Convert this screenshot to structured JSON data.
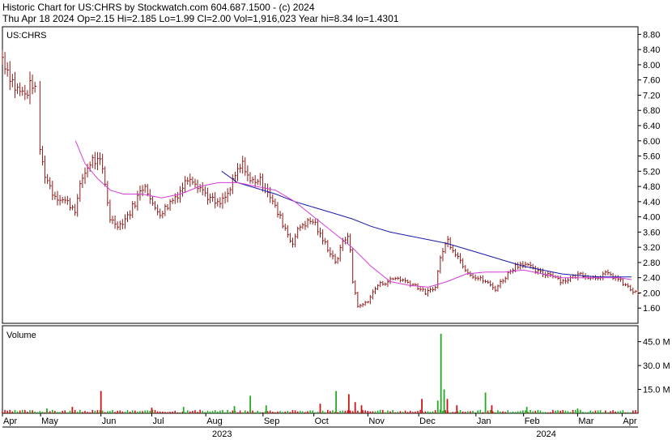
{
  "header": {
    "line1": "Historic Chart for US:CHRS by Stockwatch.com 604.687.1500 - (c) 2024",
    "line2": "Thu Apr 18 2024   Op=2.15   Hi=2.185   Lo=1.99   Cl=2.00   Vol=1,916,023   Year hi=8.34   lo=1.4301"
  },
  "chart_data": {
    "type": "ohlc",
    "symbol_label": "US:CHRS",
    "volume_label": "Volume",
    "price_axis": {
      "min": 1.2,
      "max": 9.0,
      "ticks": [
        "8.80",
        "8.40",
        "8.00",
        "7.60",
        "7.20",
        "6.80",
        "6.40",
        "6.00",
        "5.60",
        "5.20",
        "4.80",
        "4.40",
        "4.00",
        "3.60",
        "3.20",
        "2.80",
        "2.40",
        "2.00",
        "1.60"
      ]
    },
    "volume_axis": {
      "min": 0,
      "max": 55,
      "unit": "M",
      "ticks": [
        {
          "v": 45,
          "label": "45.0 M"
        },
        {
          "v": 30,
          "label": "30.0 M"
        },
        {
          "v": 15,
          "label": "15.0 M"
        }
      ]
    },
    "months": [
      {
        "label": "Apr",
        "x": 0.0
      },
      {
        "label": "May",
        "x": 0.06
      },
      {
        "label": "Jun",
        "x": 0.155
      },
      {
        "label": "Jul",
        "x": 0.235
      },
      {
        "label": "Aug",
        "x": 0.32
      },
      {
        "label": "Sep",
        "x": 0.41
      },
      {
        "label": "Oct",
        "x": 0.49
      },
      {
        "label": "Nov",
        "x": 0.575
      },
      {
        "label": "Dec",
        "x": 0.655
      },
      {
        "label": "Jan",
        "x": 0.745
      },
      {
        "label": "Feb",
        "x": 0.82
      },
      {
        "label": "Mar",
        "x": 0.905
      },
      {
        "label": "Apr",
        "x": 0.975
      }
    ],
    "years": [
      {
        "label": "2023",
        "x": 0.33
      },
      {
        "label": "2024",
        "x": 0.84
      }
    ],
    "price_series": [
      [
        0.0,
        8.2
      ],
      [
        0.02,
        7.4
      ],
      [
        0.035,
        7.2
      ],
      [
        0.05,
        7.6
      ],
      [
        0.055,
        6.2
      ],
      [
        0.065,
        5.2
      ],
      [
        0.08,
        4.6
      ],
      [
        0.1,
        4.4
      ],
      [
        0.115,
        4.2
      ],
      [
        0.125,
        5.0
      ],
      [
        0.14,
        5.5
      ],
      [
        0.155,
        5.4
      ],
      [
        0.16,
        5.0
      ],
      [
        0.17,
        3.9
      ],
      [
        0.185,
        3.8
      ],
      [
        0.2,
        4.1
      ],
      [
        0.215,
        4.6
      ],
      [
        0.225,
        4.9
      ],
      [
        0.235,
        4.3
      ],
      [
        0.25,
        4.1
      ],
      [
        0.265,
        4.4
      ],
      [
        0.28,
        4.7
      ],
      [
        0.295,
        5.1
      ],
      [
        0.31,
        4.8
      ],
      [
        0.325,
        4.5
      ],
      [
        0.34,
        4.3
      ],
      [
        0.355,
        4.6
      ],
      [
        0.37,
        5.2
      ],
      [
        0.38,
        5.4
      ],
      [
        0.39,
        4.9
      ],
      [
        0.4,
        5.0
      ],
      [
        0.415,
        4.8
      ],
      [
        0.43,
        4.2
      ],
      [
        0.445,
        3.7
      ],
      [
        0.455,
        3.3
      ],
      [
        0.47,
        3.8
      ],
      [
        0.49,
        3.9
      ],
      [
        0.5,
        3.5
      ],
      [
        0.515,
        3.1
      ],
      [
        0.525,
        2.8
      ],
      [
        0.535,
        3.3
      ],
      [
        0.545,
        3.6
      ],
      [
        0.55,
        2.4
      ],
      [
        0.56,
        1.6
      ],
      [
        0.575,
        1.8
      ],
      [
        0.59,
        2.2
      ],
      [
        0.605,
        2.3
      ],
      [
        0.62,
        2.4
      ],
      [
        0.635,
        2.3
      ],
      [
        0.65,
        2.2
      ],
      [
        0.665,
        2.0
      ],
      [
        0.68,
        2.1
      ],
      [
        0.69,
        3.0
      ],
      [
        0.7,
        3.4
      ],
      [
        0.715,
        3.0
      ],
      [
        0.73,
        2.6
      ],
      [
        0.745,
        2.4
      ],
      [
        0.76,
        2.3
      ],
      [
        0.775,
        2.1
      ],
      [
        0.79,
        2.4
      ],
      [
        0.805,
        2.7
      ],
      [
        0.82,
        2.8
      ],
      [
        0.835,
        2.6
      ],
      [
        0.85,
        2.5
      ],
      [
        0.865,
        2.5
      ],
      [
        0.88,
        2.3
      ],
      [
        0.895,
        2.4
      ],
      [
        0.91,
        2.5
      ],
      [
        0.93,
        2.4
      ],
      [
        0.95,
        2.5
      ],
      [
        0.965,
        2.4
      ],
      [
        0.98,
        2.2
      ],
      [
        0.995,
        2.0
      ]
    ],
    "ma_short": [
      [
        0.115,
        6.0
      ],
      [
        0.13,
        5.4
      ],
      [
        0.15,
        5.0
      ],
      [
        0.17,
        4.7
      ],
      [
        0.19,
        4.6
      ],
      [
        0.22,
        4.6
      ],
      [
        0.25,
        4.5
      ],
      [
        0.28,
        4.6
      ],
      [
        0.31,
        4.8
      ],
      [
        0.34,
        4.9
      ],
      [
        0.37,
        4.9
      ],
      [
        0.4,
        4.8
      ],
      [
        0.43,
        4.7
      ],
      [
        0.46,
        4.4
      ],
      [
        0.49,
        4.0
      ],
      [
        0.52,
        3.6
      ],
      [
        0.55,
        3.2
      ],
      [
        0.58,
        2.7
      ],
      [
        0.61,
        2.3
      ],
      [
        0.64,
        2.2
      ],
      [
        0.67,
        2.15
      ],
      [
        0.7,
        2.3
      ],
      [
        0.73,
        2.5
      ],
      [
        0.76,
        2.55
      ],
      [
        0.79,
        2.55
      ],
      [
        0.82,
        2.6
      ],
      [
        0.85,
        2.5
      ],
      [
        0.88,
        2.4
      ],
      [
        0.91,
        2.4
      ],
      [
        0.94,
        2.4
      ],
      [
        0.97,
        2.4
      ],
      [
        0.99,
        2.35
      ]
    ],
    "ma_long": [
      [
        0.345,
        5.2
      ],
      [
        0.37,
        4.9
      ],
      [
        0.4,
        4.75
      ],
      [
        0.43,
        4.6
      ],
      [
        0.46,
        4.4
      ],
      [
        0.49,
        4.25
      ],
      [
        0.52,
        4.1
      ],
      [
        0.55,
        3.95
      ],
      [
        0.58,
        3.75
      ],
      [
        0.61,
        3.6
      ],
      [
        0.64,
        3.5
      ],
      [
        0.67,
        3.4
      ],
      [
        0.7,
        3.3
      ],
      [
        0.73,
        3.15
      ],
      [
        0.76,
        3.0
      ],
      [
        0.79,
        2.85
      ],
      [
        0.82,
        2.7
      ],
      [
        0.85,
        2.6
      ],
      [
        0.88,
        2.5
      ],
      [
        0.91,
        2.45
      ],
      [
        0.94,
        2.42
      ],
      [
        0.97,
        2.42
      ],
      [
        0.99,
        2.42
      ]
    ],
    "volume_spikes": [
      {
        "x": 0.07,
        "v": 3.0,
        "c": "g"
      },
      {
        "x": 0.11,
        "v": 4.0,
        "c": "r"
      },
      {
        "x": 0.155,
        "v": 14.0,
        "c": "r"
      },
      {
        "x": 0.235,
        "v": 3.5,
        "c": "r"
      },
      {
        "x": 0.285,
        "v": 4.0,
        "c": "g"
      },
      {
        "x": 0.365,
        "v": 4.5,
        "c": "g"
      },
      {
        "x": 0.39,
        "v": 11.0,
        "c": "g"
      },
      {
        "x": 0.415,
        "v": 5.0,
        "c": "g"
      },
      {
        "x": 0.5,
        "v": 6.0,
        "c": "r"
      },
      {
        "x": 0.525,
        "v": 14.0,
        "c": "g"
      },
      {
        "x": 0.545,
        "v": 12.0,
        "c": "r"
      },
      {
        "x": 0.555,
        "v": 7.0,
        "c": "r"
      },
      {
        "x": 0.565,
        "v": 5.0,
        "c": "r"
      },
      {
        "x": 0.66,
        "v": 9.0,
        "c": "r"
      },
      {
        "x": 0.685,
        "v": 8.0,
        "c": "g"
      },
      {
        "x": 0.69,
        "v": 50.0,
        "c": "g"
      },
      {
        "x": 0.695,
        "v": 15.0,
        "c": "g"
      },
      {
        "x": 0.7,
        "v": 9.0,
        "c": "r"
      },
      {
        "x": 0.715,
        "v": 5.0,
        "c": "r"
      },
      {
        "x": 0.76,
        "v": 13.0,
        "c": "g"
      },
      {
        "x": 0.77,
        "v": 5.0,
        "c": "r"
      },
      {
        "x": 0.825,
        "v": 4.0,
        "c": "g"
      },
      {
        "x": 0.905,
        "v": 3.0,
        "c": "g"
      }
    ]
  },
  "colors": {
    "price_bar": "#8b1a1a",
    "ma_short": "#d63cd6",
    "ma_long": "#1a1aa8",
    "vol_up": "#22a822",
    "vol_down": "#c81414",
    "grid": "#000000"
  }
}
